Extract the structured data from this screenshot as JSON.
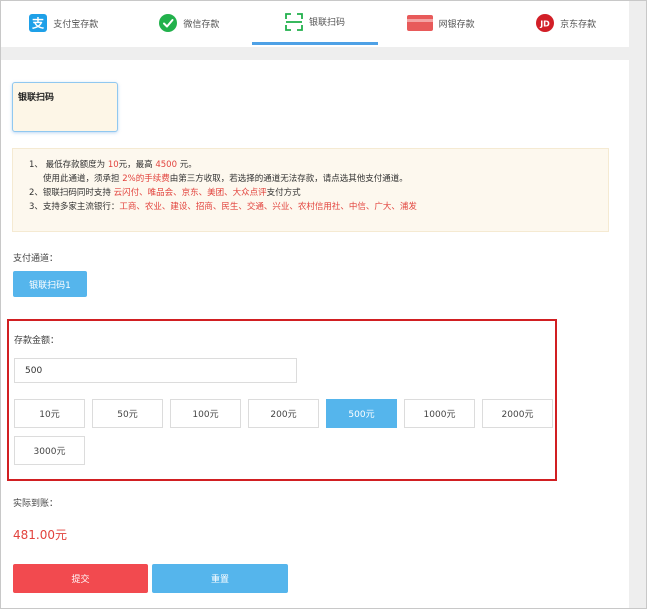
{
  "tabs": [
    {
      "label": "支付宝存款",
      "icon": "alipay-icon",
      "color": "#1ea0e8"
    },
    {
      "label": "微信存款",
      "icon": "wechat-icon",
      "color": "#22b14c"
    },
    {
      "label": "银联扫码",
      "icon": "scan-icon",
      "color": "#22b14c",
      "active": true
    },
    {
      "label": "网银存款",
      "icon": "bank-card-icon",
      "color": "#e85a5a"
    },
    {
      "label": "京东存款",
      "icon": "jd-icon",
      "color": "#d21f27",
      "icon_text": "JD"
    }
  ],
  "method_card": {
    "label": "银联扫码"
  },
  "notice": {
    "line1_prefix": "1、 最低存款额度为 ",
    "line1_min": "10",
    "line1_mid": "元，最高 ",
    "line1_max": "4500",
    "line1_suffix": " 元。",
    "line2_prefix": "使用此通道，须承担 ",
    "line2_fee": "2%的手续费",
    "line2_suffix": "由第三方收取，若选择的通道无法存款，请点选其他支付通道。",
    "line3_prefix": "2、银联扫码同时支持 ",
    "line3_apps": "云闪付、唯品会、京东、美团、大众点评",
    "line3_suffix": "支付方式",
    "line4_prefix": "3、支持多家主流银行：",
    "line4_banks": "工商、农业、建设、招商、民生、交通、兴业、农村信用社、中信、广大、浦发"
  },
  "channel": {
    "label": "支付通道：",
    "button": "银联扫码1"
  },
  "amount": {
    "label": "存款金额：",
    "value": "500",
    "options": [
      "10元",
      "50元",
      "100元",
      "200元",
      "500元",
      "1000元",
      "2000元",
      "3000元"
    ],
    "selected_index": 4
  },
  "actual": {
    "label": "实际到账：",
    "value": "481.00元"
  },
  "actions": {
    "submit": "提交",
    "reset": "重置"
  },
  "colors": {
    "accent": "#55b5ec",
    "danger": "#e2433d",
    "submit": "#f24a4f",
    "highlight_border": "#d11f22"
  }
}
